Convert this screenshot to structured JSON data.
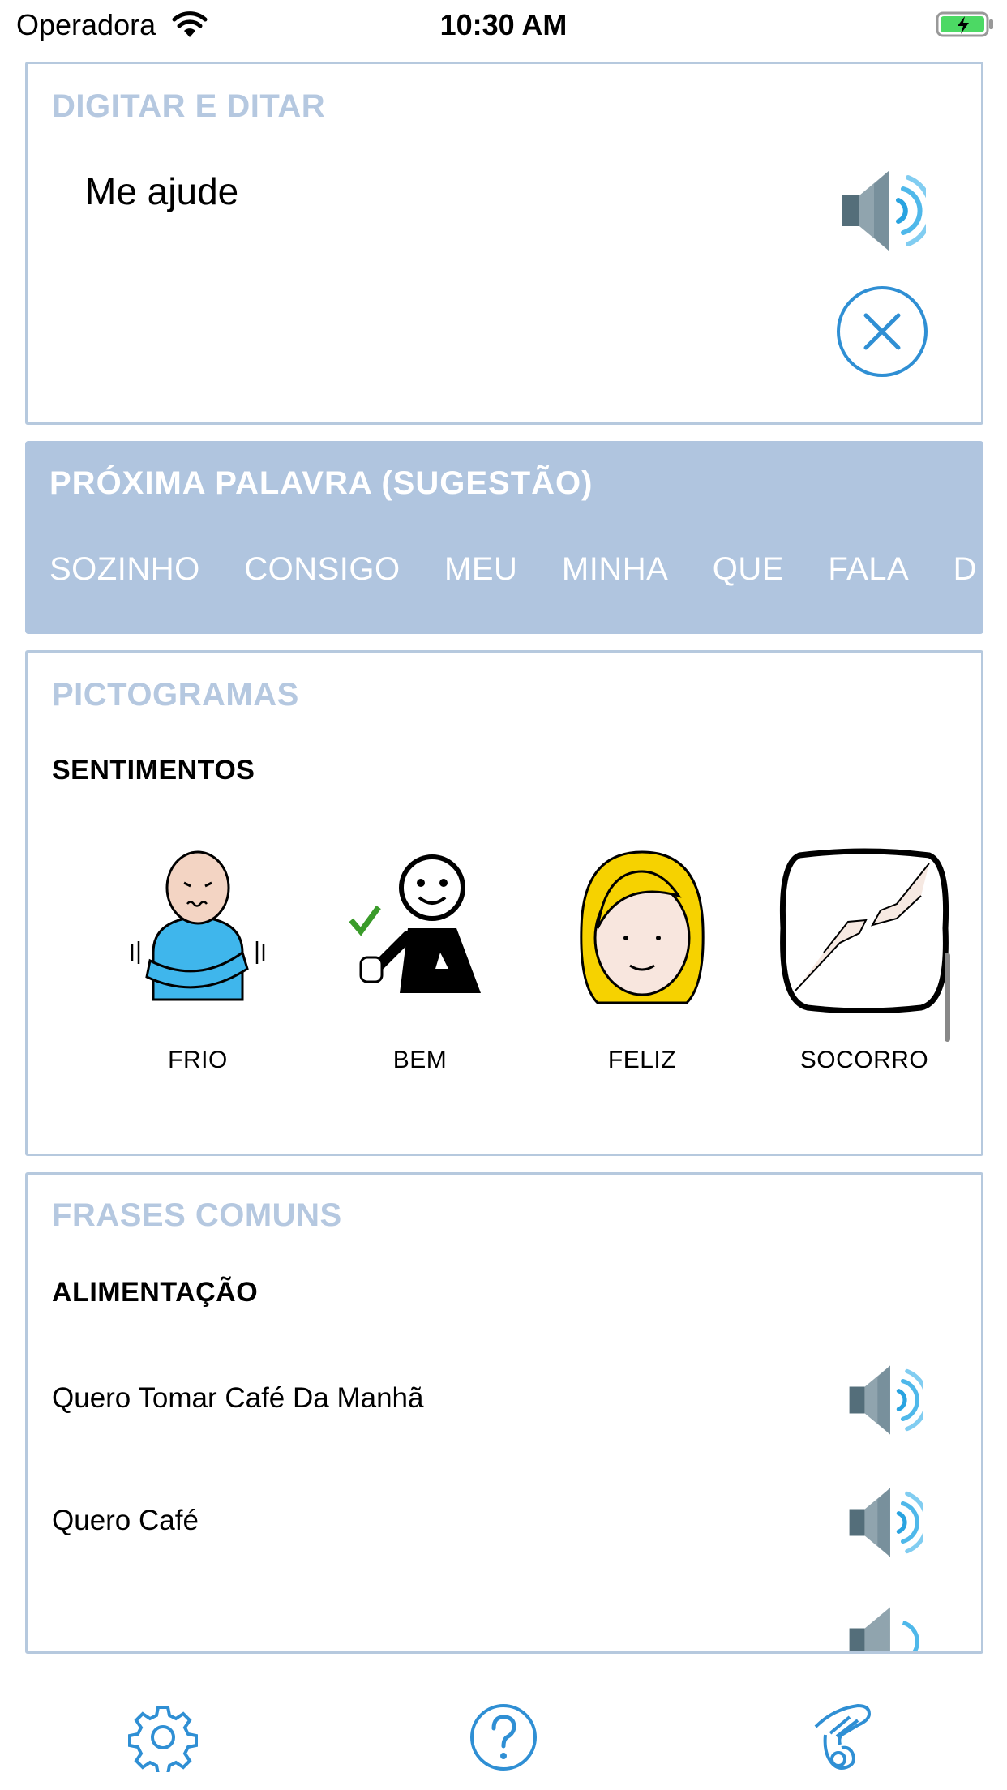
{
  "status_bar": {
    "carrier": "Operadora",
    "time": "10:30 AM"
  },
  "typing": {
    "title": "DIGITAR E DITAR",
    "text": "Me ajude",
    "speak_icon": "speaker-icon",
    "clear_icon": "close-icon"
  },
  "suggestions": {
    "title": "PRÓXIMA PALAVRA (SUGESTÃO)",
    "words": [
      "SOZINHO",
      "CONSIGO",
      "MEU",
      "MINHA",
      "QUE",
      "FALA",
      "D"
    ]
  },
  "pictograms": {
    "title": "PICTOGRAMAS",
    "category": "SENTIMENTOS",
    "items": [
      {
        "label": "FRIO",
        "icon": "cold-person-icon"
      },
      {
        "label": "BEM",
        "icon": "thumbs-up-person-icon"
      },
      {
        "label": "FELIZ",
        "icon": "happy-face-icon"
      },
      {
        "label": "SOCORRO",
        "icon": "helping-hands-icon"
      }
    ]
  },
  "phrases": {
    "title": "FRASES COMUNS",
    "category": "ALIMENTAÇÃO",
    "items": [
      {
        "text": "Quero Tomar Café Da Manhã"
      },
      {
        "text": "Quero Café"
      }
    ]
  },
  "tabbar": {
    "icons": [
      "gear-icon",
      "help-icon",
      "sign-language-icon"
    ]
  },
  "colors": {
    "accent": "#2f8fd4",
    "section_title": "#b5c8e0",
    "suggest_bg": "#b0c5df",
    "border": "#b6c9de"
  }
}
